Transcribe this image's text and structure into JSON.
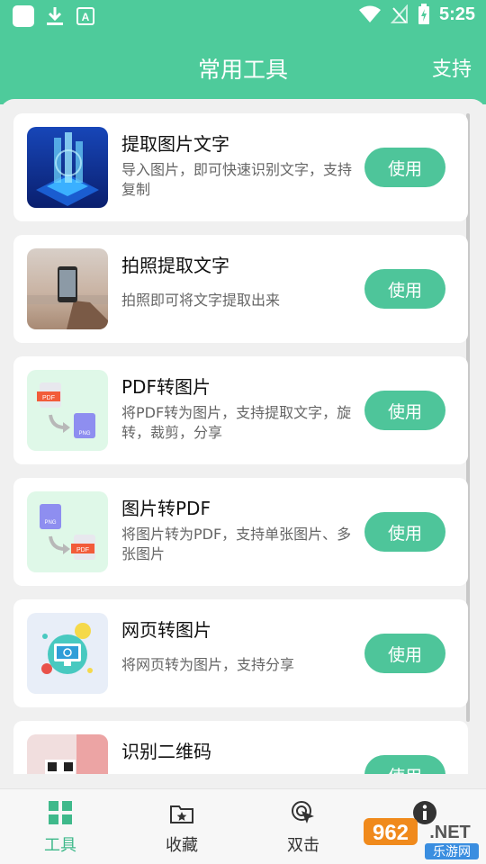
{
  "status_bar": {
    "time": "5:25"
  },
  "header": {
    "title": "常用工具",
    "support_label": "支持"
  },
  "tools": [
    {
      "title": "提取图片文字",
      "desc": "导入图片，即可快速识别文字，支持复制",
      "button": "使用",
      "icon": "ai-chip-image"
    },
    {
      "title": "拍照提取文字",
      "desc": "拍照即可将文字提取出来",
      "button": "使用",
      "icon": "phone-camera-photo"
    },
    {
      "title": "PDF转图片",
      "desc": "将PDF转为图片，支持提取文字，旋转，裁剪，分享",
      "button": "使用",
      "icon": "pdf-to-png-icon"
    },
    {
      "title": "图片转PDF",
      "desc": "将图片转为PDF，支持单张图片、多张图片",
      "button": "使用",
      "icon": "png-to-pdf-icon"
    },
    {
      "title": "网页转图片",
      "desc": "将网页转为图片，支持分享",
      "button": "使用",
      "icon": "webpage-icon"
    },
    {
      "title": "识别二维码",
      "desc": "",
      "button": "使用",
      "icon": "qr-code-icon"
    }
  ],
  "icon_labels": {
    "pdf": "PDF",
    "png": "PNG"
  },
  "bottom_nav": [
    {
      "label": "工具",
      "icon": "grid-icon",
      "active": true
    },
    {
      "label": "收藏",
      "icon": "folder-star-icon",
      "active": false
    },
    {
      "label": "双击",
      "icon": "double-tap-icon",
      "active": false
    },
    {
      "label": "",
      "icon": "info-icon",
      "active": false
    }
  ],
  "watermark": {
    "number": "962",
    "suffix": ".NET",
    "site": "乐游网"
  },
  "colors": {
    "primary": "#4ecb9b",
    "button": "#4ec59a",
    "active_nav": "#3fb98b",
    "pdf_red": "#f25c3a",
    "png_purple": "#8e8ef0"
  }
}
